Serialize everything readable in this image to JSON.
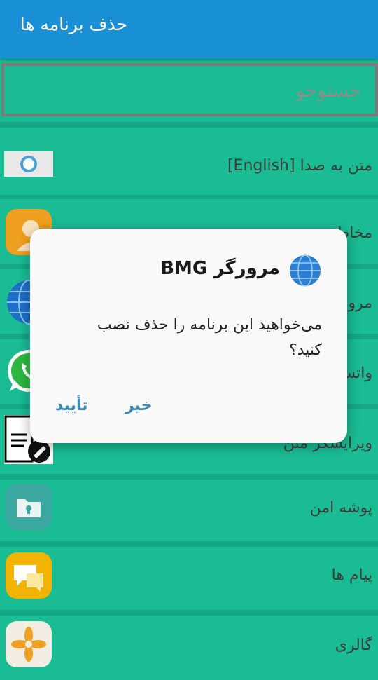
{
  "app_bar": {
    "title": "حذف برنامه ها"
  },
  "search": {
    "placeholder": "جستوجو"
  },
  "apps": [
    {
      "label": "متن به صدا [English]",
      "icon": "speech-bubble-icon"
    },
    {
      "label": "مخاطبین",
      "icon": "contacts-icon"
    },
    {
      "label": "مرورگر BMG",
      "icon": "globe-icon"
    },
    {
      "label": "واتساپ",
      "icon": "whatsapp-icon"
    },
    {
      "label": "ویرایشگر متن",
      "icon": "document-edit-icon"
    },
    {
      "label": "پوشه امن",
      "icon": "secure-folder-icon"
    },
    {
      "label": "پیام ها",
      "icon": "messages-icon"
    },
    {
      "label": "گالری",
      "icon": "gallery-flower-icon"
    }
  ],
  "dialog": {
    "title": "مرورگر BMG",
    "icon": "globe-icon",
    "message": "می‌خواهید این برنامه را حذف نصب کنید؟",
    "cancel_label": "خیر",
    "confirm_label": "تأیید"
  },
  "colors": {
    "app_bar": "#1b8fd6",
    "list_bg": "#1abc94",
    "button_text": "#3d8ab8"
  }
}
